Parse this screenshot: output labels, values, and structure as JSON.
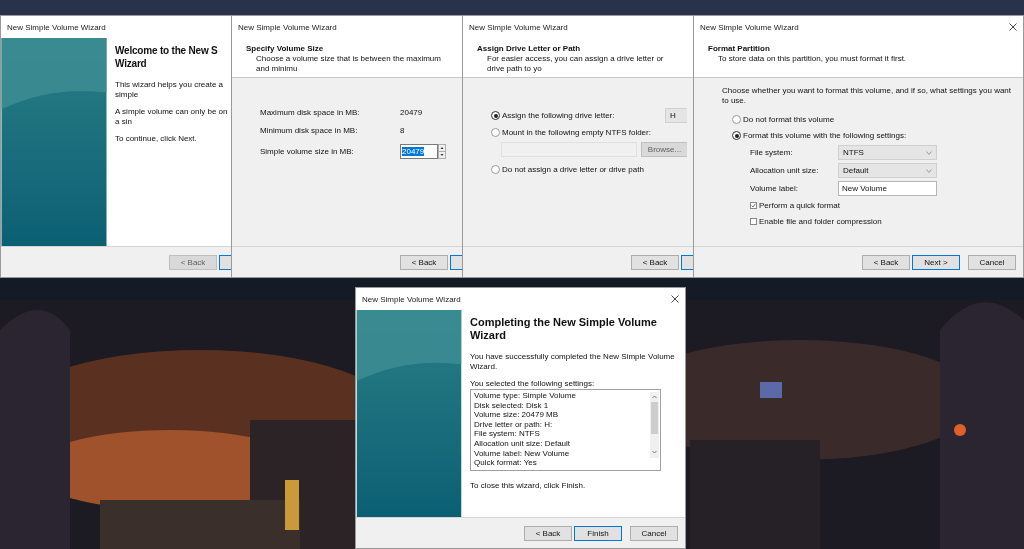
{
  "windows": [
    {
      "kind": "sidebar",
      "title": "New Simple Volume Wizard",
      "heading": [
        "Welcome to the New S",
        "Wizard"
      ],
      "items": [
        {
          "kind": "text",
          "text": "This wizard helps you create a simple"
        },
        {
          "kind": "text",
          "text": "A simple volume can only be on a sin"
        },
        {
          "kind": "text",
          "text": "To continue, click Next."
        }
      ],
      "buttons": [
        {
          "label": "< Back",
          "disabled": true,
          "default": false
        }
      ],
      "covered_button": true
    },
    {
      "kind": "page",
      "title": "New Simple Volume Wizard",
      "header": {
        "title": "Specify Volume Size",
        "subtitle": "Choose a volume size that is between the maximum and minimu"
      },
      "items": [
        {
          "kind": "value",
          "label": "Maximum disk space in MB:",
          "value": "20479"
        },
        {
          "kind": "value",
          "label": "Minimum disk space in MB:",
          "value": "8"
        },
        {
          "kind": "spin",
          "label": "Simple volume size in MB:",
          "value": "20479",
          "selected": true
        }
      ],
      "buttons": [
        {
          "label": "< Back",
          "disabled": false,
          "default": false
        }
      ],
      "covered_button": true
    },
    {
      "kind": "page",
      "title": "New Simple Volume Wizard",
      "header": {
        "title": "Assign Drive Letter or Path",
        "subtitle": "For easier access, you can assign a drive letter or drive path to yo"
      },
      "items": [
        {
          "kind": "radio",
          "label": "Assign the following drive letter:",
          "selected": true,
          "dropdown": "H"
        },
        {
          "kind": "radio",
          "label": "Mount in the following empty NTFS folder:",
          "selected": false
        },
        {
          "kind": "path",
          "button": "Browse...",
          "disabled": true
        },
        {
          "kind": "radio",
          "label": "Do not assign a drive letter or drive path",
          "selected": false
        }
      ],
      "buttons": [
        {
          "label": "< Back",
          "disabled": false,
          "default": false
        }
      ],
      "covered_button": true
    },
    {
      "kind": "page",
      "title": "New Simple Volume Wizard",
      "close": true,
      "header": {
        "title": "Format Partition",
        "subtitle": "To store data on this partition, you must format it first."
      },
      "items": [
        {
          "kind": "text",
          "text": "Choose whether you want to format this volume, and if so, what settings you want to use."
        },
        {
          "kind": "radio",
          "label": "Do not format this volume",
          "selected": false
        },
        {
          "kind": "radio",
          "label": "Format this volume with the following settings:",
          "selected": true
        },
        {
          "kind": "dropdown",
          "label": "File system:",
          "value": "NTFS"
        },
        {
          "kind": "dropdown",
          "label": "Allocation unit size:",
          "value": "Default"
        },
        {
          "kind": "input",
          "label": "Volume label:",
          "value": "New Volume"
        },
        {
          "kind": "checkbox",
          "label": "Perform a quick format",
          "checked": true
        },
        {
          "kind": "checkbox",
          "label": "Enable file and folder compression",
          "checked": false
        }
      ],
      "buttons": [
        {
          "label": "< Back",
          "disabled": false,
          "default": false
        },
        {
          "label": "Next >",
          "disabled": false,
          "default": true
        },
        {
          "label": "Cancel",
          "disabled": false,
          "default": false
        }
      ]
    },
    {
      "kind": "sidebar",
      "title": "New Simple Volume Wizard",
      "close": true,
      "heading": [
        "Completing the New Simple Volume",
        "Wizard"
      ],
      "items": [
        {
          "kind": "text",
          "text": "You have successfully completed the New Simple Volume Wizard."
        },
        {
          "kind": "listbox",
          "label": "You selected the following settings:",
          "lines": [
            "Volume type: Simple Volume",
            "Disk selected: Disk 1",
            "Volume size: 20479 MB",
            "Drive letter or path: H:",
            "File system: NTFS",
            "Allocation unit size: Default",
            "Volume label: New Volume",
            "Quick format: Yes"
          ]
        },
        {
          "kind": "text",
          "text": "To close this wizard, click Finish."
        }
      ],
      "buttons": [
        {
          "label": "< Back",
          "disabled": false,
          "default": false
        },
        {
          "label": "Finish",
          "disabled": false,
          "default": true
        },
        {
          "label": "Cancel",
          "disabled": false,
          "default": false
        }
      ]
    }
  ]
}
